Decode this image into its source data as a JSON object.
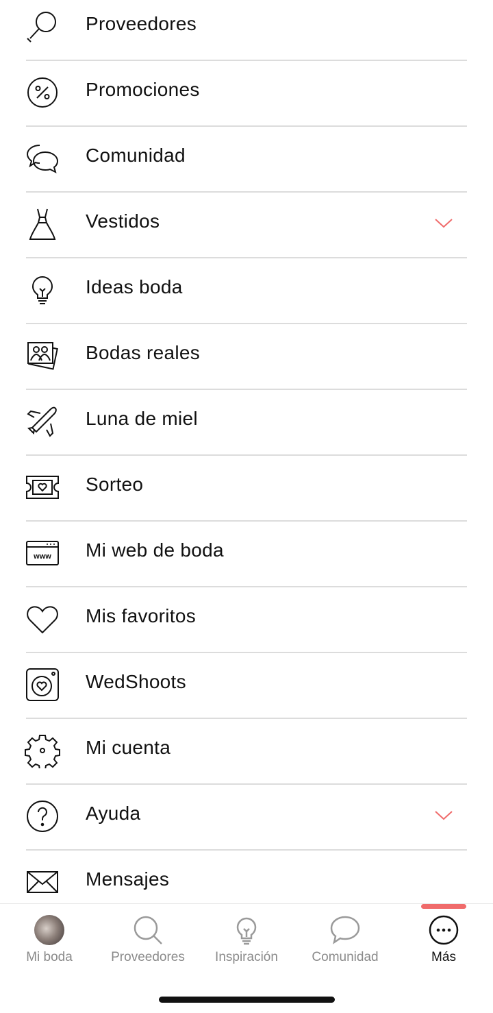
{
  "menu": {
    "items": [
      {
        "label": "Proveedores",
        "icon": "search-icon"
      },
      {
        "label": "Promociones",
        "icon": "percent-icon"
      },
      {
        "label": "Comunidad",
        "icon": "chat-bubbles-icon"
      },
      {
        "label": "Vestidos",
        "icon": "dress-icon",
        "expandable": true
      },
      {
        "label": "Ideas boda",
        "icon": "lightbulb-icon"
      },
      {
        "label": "Bodas reales",
        "icon": "photos-icon"
      },
      {
        "label": "Luna de miel",
        "icon": "airplane-icon"
      },
      {
        "label": "Sorteo",
        "icon": "ticket-icon"
      },
      {
        "label": "Mi web de boda",
        "icon": "website-icon"
      },
      {
        "label": "Mis favoritos",
        "icon": "heart-icon"
      },
      {
        "label": "WedShoots",
        "icon": "camera-icon"
      },
      {
        "label": "Mi cuenta",
        "icon": "gear-icon"
      },
      {
        "label": "Ayuda",
        "icon": "help-icon",
        "expandable": true
      },
      {
        "label": "Mensajes",
        "icon": "envelope-icon"
      }
    ],
    "website_icon_text": "www"
  },
  "tabbar": {
    "tabs": [
      {
        "label": "Mi boda",
        "icon": "avatar"
      },
      {
        "label": "Proveedores",
        "icon": "search-icon"
      },
      {
        "label": "Inspiración",
        "icon": "lightbulb-icon"
      },
      {
        "label": "Comunidad",
        "icon": "chat-bubble-icon"
      },
      {
        "label": "Más",
        "icon": "more-icon",
        "active": true
      }
    ]
  },
  "colors": {
    "accent": "#f06b6b",
    "text": "#111111",
    "muted": "#8a8a8a",
    "divider": "#dcdcdc"
  }
}
